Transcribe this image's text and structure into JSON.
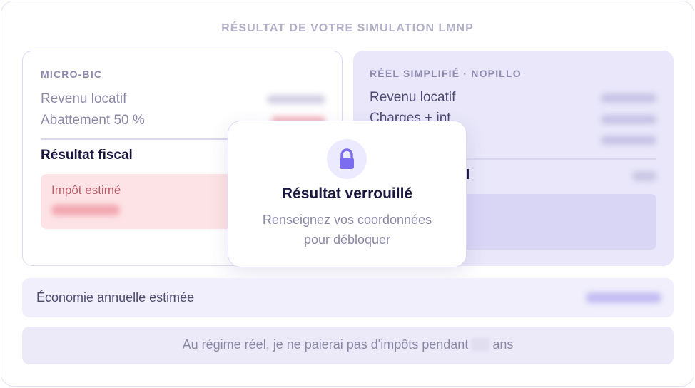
{
  "heading": "RÉSULTAT DE VOTRE SIMULATION LMNP",
  "micro_bic": {
    "title": "MICRO-BIC",
    "rows": [
      "Revenu locatif",
      "Abattement 50 %"
    ],
    "result_label": "Résultat fiscal",
    "tax_label": "Impôt estimé"
  },
  "reel": {
    "title": "RÉEL SIMPLIFIÉ · NOPILLO",
    "rows": [
      "Revenu locatif",
      "Charges + int."
    ],
    "result_label_fragment": "l"
  },
  "lock": {
    "icon": "lock-icon",
    "title": "Résultat verrouillé",
    "subtitle_line1": "Renseignez vos coordonnées",
    "subtitle_line2": "pour débloquer"
  },
  "savings": {
    "label": "Économie annuelle estimée"
  },
  "footer": {
    "text_before": "Au régime réel, je ne paierai pas d'impôts pendant",
    "text_after": "ans"
  },
  "colors": {
    "accent": "#7b6cf0",
    "heading": "#b1b0c8",
    "tax_box": "#fde3e5",
    "reel_card": "#e9e7f9"
  }
}
